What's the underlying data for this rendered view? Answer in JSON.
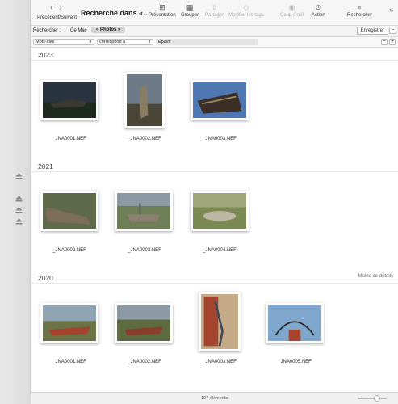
{
  "toolbar": {
    "nav_label": "Précédent/Suivant",
    "title": "Recherche dans «…",
    "items": [
      {
        "label": "Présentation",
        "glyph": "⊞"
      },
      {
        "label": "Grouper",
        "glyph": "▦"
      },
      {
        "label": "Partager",
        "glyph": "⇧"
      },
      {
        "label": "Modifier les tags",
        "glyph": "◇"
      },
      {
        "label": "Coup d'œil",
        "glyph": "◉"
      },
      {
        "label": "Action",
        "glyph": "⊙"
      },
      {
        "label": "Rechercher",
        "glyph": "⌕"
      }
    ]
  },
  "search": {
    "label": "Rechercher :",
    "scope_mac": "Ce Mac",
    "scope_photos": "« Photos »",
    "save": "Enregistrer"
  },
  "criteria": {
    "attribute": "Mots-clés",
    "operator": "correspond à",
    "value": "Épave"
  },
  "groups": [
    {
      "year": "2023",
      "detail": "",
      "items": [
        "_JNA0001.NEF",
        "_JNA0002.NEF",
        "_JNA0003.NEF"
      ]
    },
    {
      "year": "2021",
      "detail": "",
      "items": [
        "_JNA0002.NEF",
        "_JNA0003.NEF",
        "_JNA0004.NEF"
      ]
    },
    {
      "year": "2020",
      "detail": "Moins de détails",
      "items": [
        "_JNA0001.NEF",
        "_JNA0002.NEF",
        "_JNA0003.NEF",
        "_JNA0005.NEF"
      ]
    }
  ],
  "status": {
    "count": "107 éléments"
  }
}
